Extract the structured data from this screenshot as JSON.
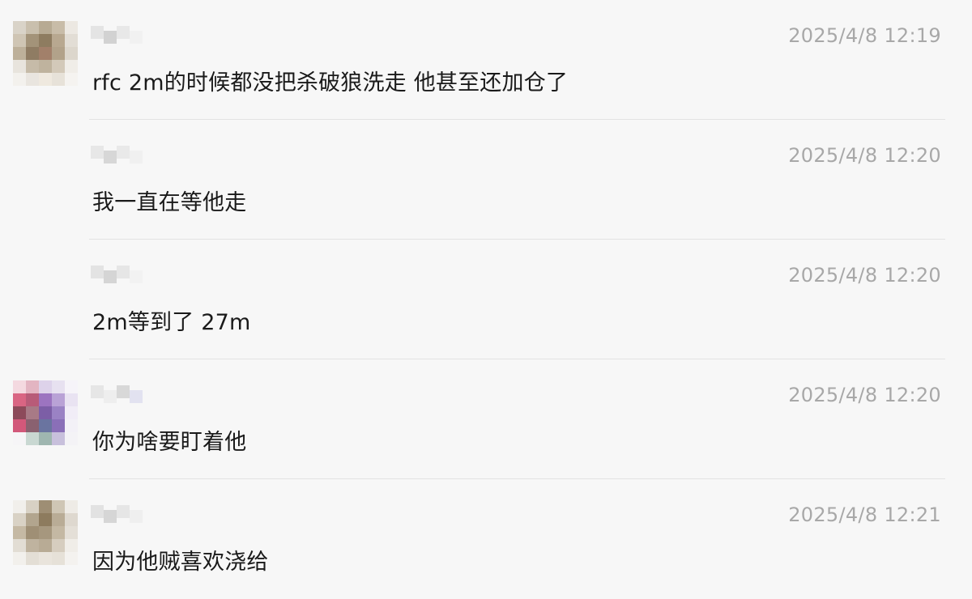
{
  "messages": [
    {
      "timestamp": "2025/4/8 12:19",
      "text": "rfc 2m的时候都没把杀破狼洗走 他甚至还加仓了",
      "show_avatar": true,
      "avatar_colors": [
        "#d9d3c8",
        "#c9bfad",
        "#b7aa93",
        "#c8bca8",
        "#ece8e2",
        "#cfc5b4",
        "#a39379",
        "#8e7c60",
        "#b8a890",
        "#e2ddd5",
        "#bdb09a",
        "#8f7c63",
        "#a2806a",
        "#b2a28a",
        "#dcd6cc",
        "#e8e4dd",
        "#c6bba8",
        "#bfb39e",
        "#d3c9b9",
        "#f0ede8",
        "#f3f1ed",
        "#e9e5df",
        "#efe9df",
        "#e7e2d9",
        "#f5f3f0"
      ],
      "name_colors": [
        "#e4e4e4",
        "#d2d2d2",
        "#e8e8e8",
        "#f1f1f1"
      ]
    },
    {
      "timestamp": "2025/4/8 12:20",
      "text": "我一直在等他走",
      "show_avatar": false,
      "avatar_colors": [],
      "name_colors": [
        "#e7e7e7",
        "#d7d7d7",
        "#e9e9e9",
        "#f0f0f0"
      ]
    },
    {
      "timestamp": "2025/4/8 12:20",
      "text": "2m等到了 27m",
      "show_avatar": false,
      "avatar_colors": [],
      "name_colors": [
        "#e3e3e3",
        "#d5d5d5",
        "#e6e6e6",
        "#f2f2f2"
      ]
    },
    {
      "timestamp": "2025/4/8 12:20",
      "text": "你为啥要盯着他",
      "show_avatar": true,
      "avatar_colors": [
        "#f4d9e0",
        "#e3b5c2",
        "#ddd2ea",
        "#e7e1f0",
        "#f6f4f9",
        "#d96583",
        "#b85b78",
        "#9c74c0",
        "#b9a2d6",
        "#e9e3f2",
        "#8c4a5a",
        "#a87a86",
        "#7c5ea6",
        "#9a82c4",
        "#f1edf7",
        "#d2587a",
        "#8a6170",
        "#6a74a0",
        "#8a6fb8",
        "#f3f1f7",
        "#f6f5f7",
        "#c9d8d2",
        "#9fb6b0",
        "#c8c0dc",
        "#f4f3f6"
      ],
      "name_colors": [
        "#e6e6e6",
        "#eeeeee",
        "#d8d8d8",
        "#e2e2f0"
      ]
    },
    {
      "timestamp": "2025/4/8 12:21",
      "text": "因为他贼喜欢浇给",
      "show_avatar": true,
      "avatar_colors": [
        "#f1efeb",
        "#d8d1c4",
        "#9e8e74",
        "#cfc6b5",
        "#eeebe6",
        "#d9d2c5",
        "#b2a58e",
        "#8d7b5e",
        "#b9ac96",
        "#ded8cf",
        "#c5b9a4",
        "#9f8f75",
        "#a6977e",
        "#c4b8a3",
        "#e4dfd7",
        "#e2ddd4",
        "#bfb39f",
        "#b8ab95",
        "#d6cdbf",
        "#f0ede8",
        "#f2f0ec",
        "#e3ded5",
        "#e9e4dc",
        "#e6e1d8",
        "#f4f2ef"
      ],
      "name_colors": [
        "#e2e2e2",
        "#d6d6d6",
        "#e6e6e6",
        "#efefef"
      ]
    }
  ]
}
